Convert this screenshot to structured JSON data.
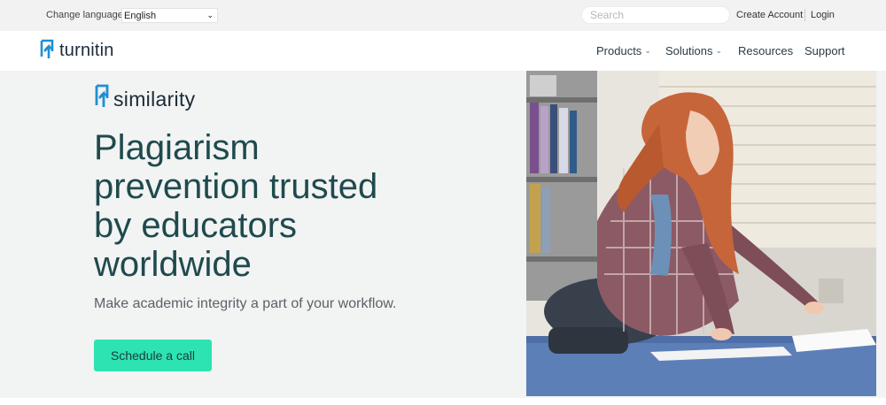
{
  "utility_bar": {
    "change_language_label": "Change language",
    "language_selected": "English",
    "search_placeholder": "Search",
    "create_account": "Create Account",
    "login": "Login"
  },
  "nav": {
    "logo_text": "turnitin",
    "items": [
      {
        "label": "Products",
        "has_dropdown": true
      },
      {
        "label": "Solutions",
        "has_dropdown": true
      },
      {
        "label": "Resources",
        "has_dropdown": false
      },
      {
        "label": "Support",
        "has_dropdown": false
      }
    ]
  },
  "hero": {
    "product_name": "similarity",
    "headline_lines": [
      "Plagiarism",
      "prevention trusted",
      "by educators",
      "worldwide"
    ],
    "subtext": "Make academic integrity a part of your workflow.",
    "cta_label": "Schedule a call",
    "image_icon": "student-studying-on-library-floor-photo"
  },
  "colors": {
    "brand_blue": "#1e8fd6",
    "headline": "#1f4a4d",
    "cta": "#2de3b2",
    "hero_bg": "#f2f3f3",
    "utility_bg": "#f2f2f2"
  }
}
